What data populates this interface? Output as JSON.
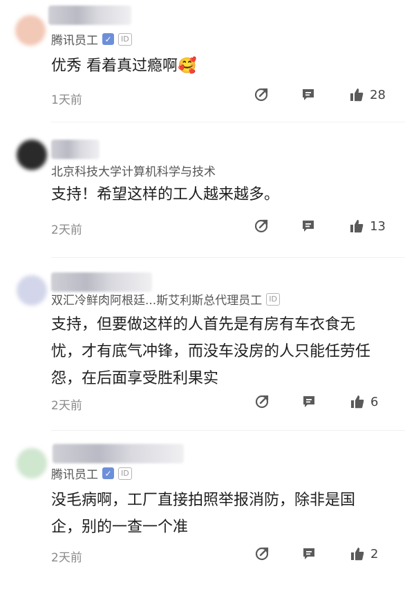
{
  "comments": [
    {
      "author": "腾讯员工",
      "verified": "✓",
      "id_badge": "ID",
      "text": "优秀 看着真过瘾啊🥰",
      "time": "1天前",
      "likes": "28"
    },
    {
      "author": "北京科技大学计算机科学与技术",
      "text": "支持！希望这样的工人越来越多。",
      "time": "2天前",
      "likes": "13"
    },
    {
      "author": "双汇冷鲜肉阿根廷...斯艾利斯总代理员工",
      "id_badge": "ID",
      "text": "支持，但要做这样的人首先是有房有车衣食无忧，才有底气冲锋，而没车没房的人只能任劳任怨，在后面享受胜利果实",
      "time": "2天前",
      "likes": "6"
    },
    {
      "author": "腾讯员工",
      "verified": "✓",
      "id_badge": "ID",
      "text": "没毛病啊，工厂直接拍照举报消防，除非是国企，别的一查一个准",
      "time": "2天前",
      "likes": "2"
    }
  ],
  "icons": {
    "share": "share-icon",
    "reply": "reply-icon",
    "like": "thumbs-up-icon"
  }
}
